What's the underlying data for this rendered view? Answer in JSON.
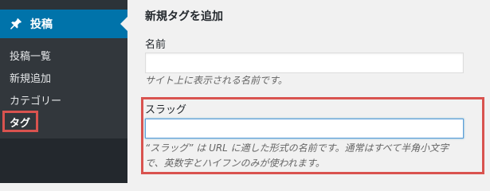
{
  "sidebar": {
    "posts_label": "投稿",
    "items": [
      {
        "label": "投稿一覧",
        "current": false
      },
      {
        "label": "新規追加",
        "current": false
      },
      {
        "label": "カテゴリー",
        "current": false
      },
      {
        "label": "タグ",
        "current": true
      }
    ]
  },
  "form": {
    "title": "新規タグを追加",
    "name": {
      "label": "名前",
      "value": "",
      "help": "サイト上に表示される名前です。"
    },
    "slug": {
      "label": "スラッグ",
      "value": "",
      "help_line1": "“スラッグ” は URL に適した形式の名前です。通常はすべて半角小文字",
      "help_line2": "で、英数字とハイフンのみが使われます。"
    }
  },
  "colors": {
    "accent": "#0073aa",
    "highlight": "#d9534f",
    "sidebar_bg": "#23282d"
  }
}
